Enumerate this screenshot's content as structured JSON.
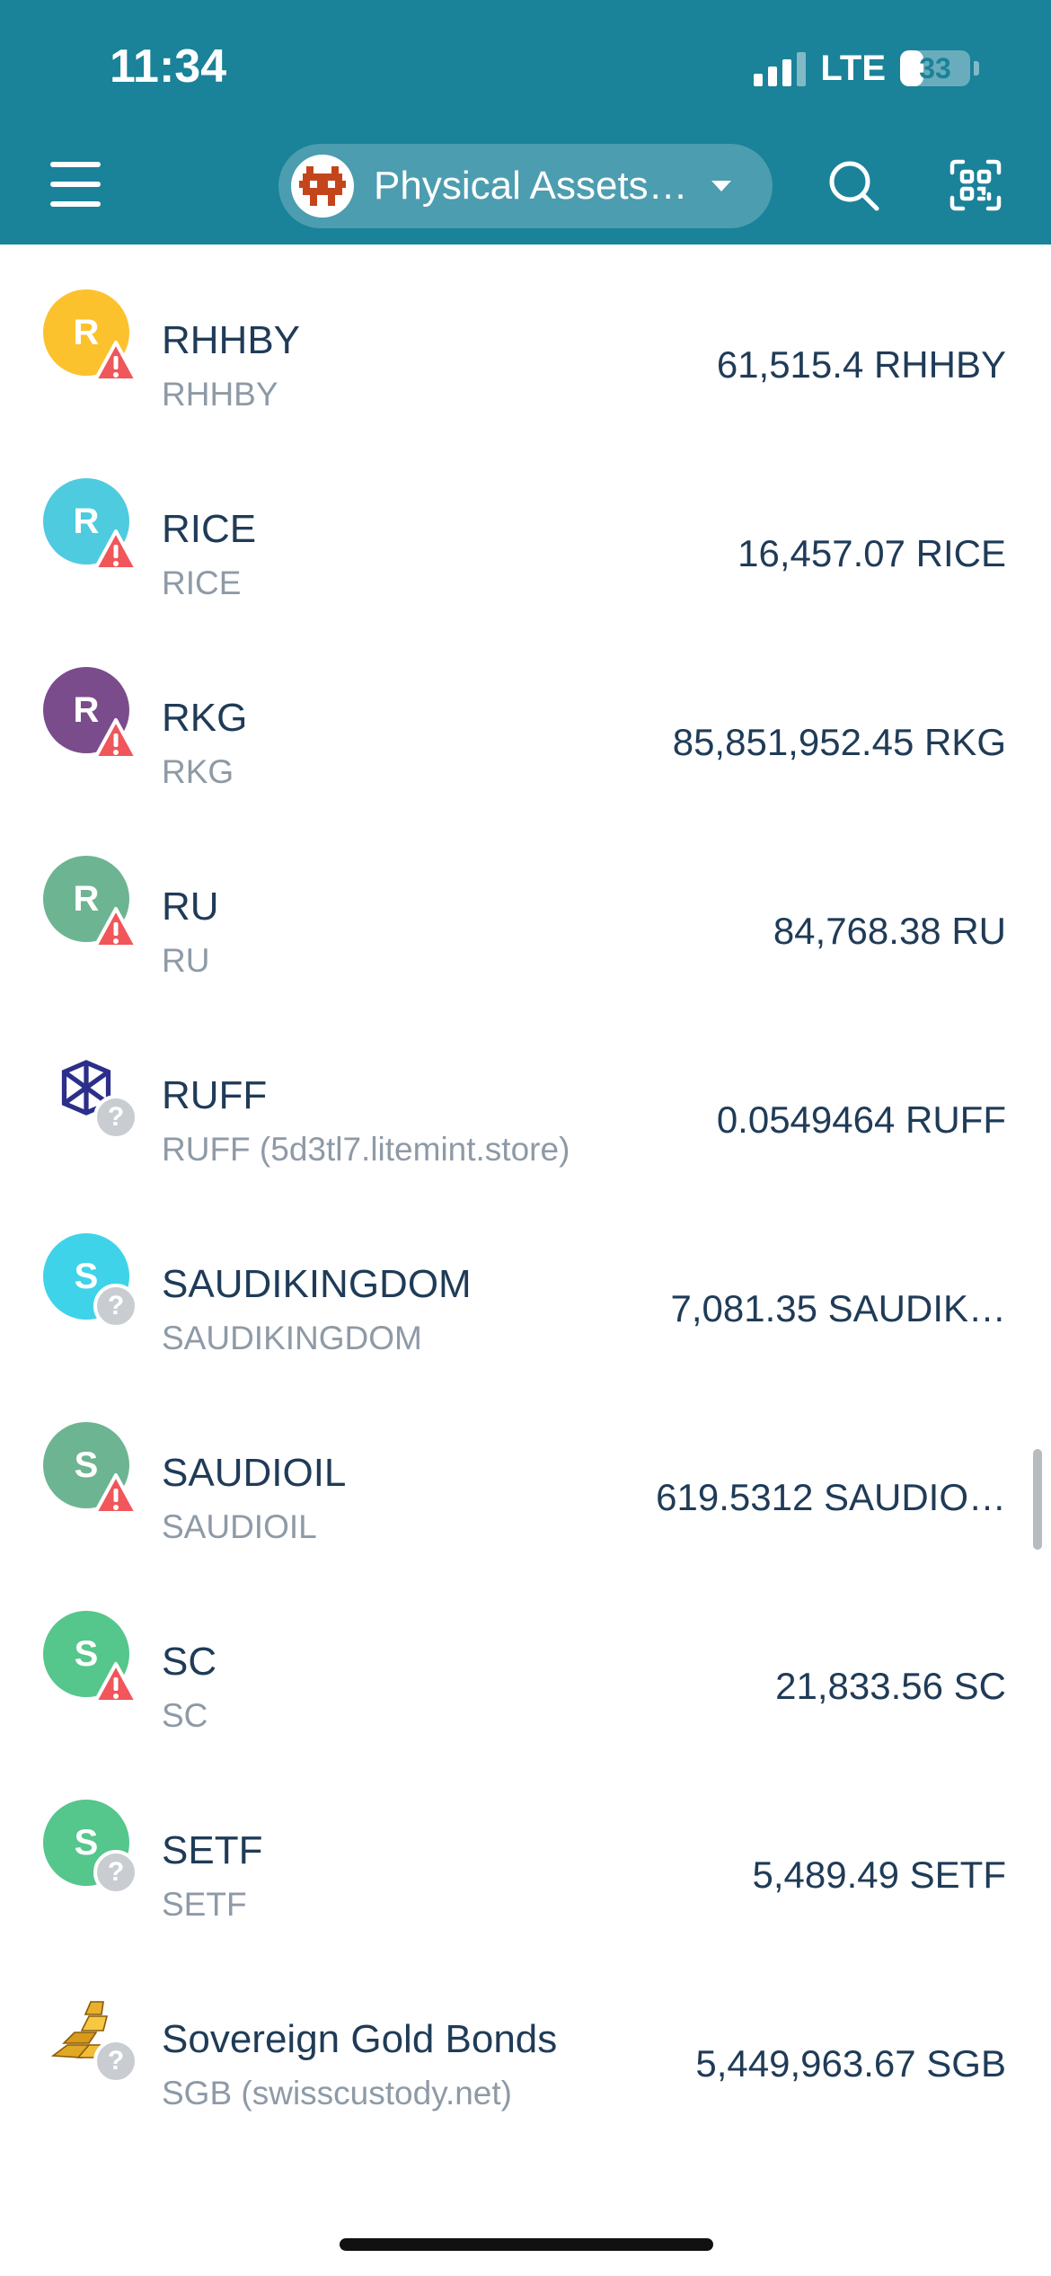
{
  "status_bar": {
    "time": "11:34",
    "network": "LTE",
    "battery": "33",
    "battery_level": 0.33
  },
  "header": {
    "account_name": "Physical Assets…"
  },
  "colors": {
    "header_bg": "#1a8299",
    "warning": "#f0565a",
    "unknown_badge": "#c9cdd2"
  },
  "assets": [
    {
      "name": "RHHBY",
      "subtitle": "RHHBY",
      "amount": "61,515.4 RHHBY",
      "letter": "R",
      "color": "#fcc22d",
      "badge": "warning"
    },
    {
      "name": "RICE",
      "subtitle": "RICE",
      "amount": "16,457.07 RICE",
      "letter": "R",
      "color": "#4ecbdf",
      "badge": "warning"
    },
    {
      "name": "RKG",
      "subtitle": "RKG",
      "amount": "85,851,952.45 RKG",
      "letter": "R",
      "color": "#7b4c8c",
      "badge": "warning"
    },
    {
      "name": "RU",
      "subtitle": "RU",
      "amount": "84,768.38 RU",
      "letter": "R",
      "color": "#6db592",
      "badge": "warning"
    },
    {
      "name": "RUFF",
      "subtitle": "RUFF (5d3tl7.litemint.store)",
      "amount": "0.0549464 RUFF",
      "letter": "",
      "icon": "ruff-logo-icon",
      "color": "#2b2f8a",
      "badge": "unknown"
    },
    {
      "name": "SAUDIKINGDOM",
      "subtitle": "SAUDIKINGDOM",
      "amount": "7,081.35 SAUDIK…",
      "letter": "S",
      "color": "#3fd3ea",
      "badge": "unknown"
    },
    {
      "name": "SAUDIOIL",
      "subtitle": "SAUDIOIL",
      "amount": "619.5312 SAUDIO…",
      "letter": "S",
      "color": "#6db592",
      "badge": "warning"
    },
    {
      "name": "SC",
      "subtitle": "SC",
      "amount": "21,833.56 SC",
      "letter": "S",
      "color": "#55c68c",
      "badge": "warning"
    },
    {
      "name": "SETF",
      "subtitle": "SETF",
      "amount": "5,489.49 SETF",
      "letter": "S",
      "color": "#55c68c",
      "badge": "unknown"
    },
    {
      "name": "Sovereign Gold Bonds",
      "subtitle": "SGB (swisscustody.net)",
      "amount": "5,449,963.67 SGB",
      "letter": "",
      "icon": "gold-bars-icon",
      "color": "#d9a21e",
      "badge": "unknown"
    }
  ]
}
